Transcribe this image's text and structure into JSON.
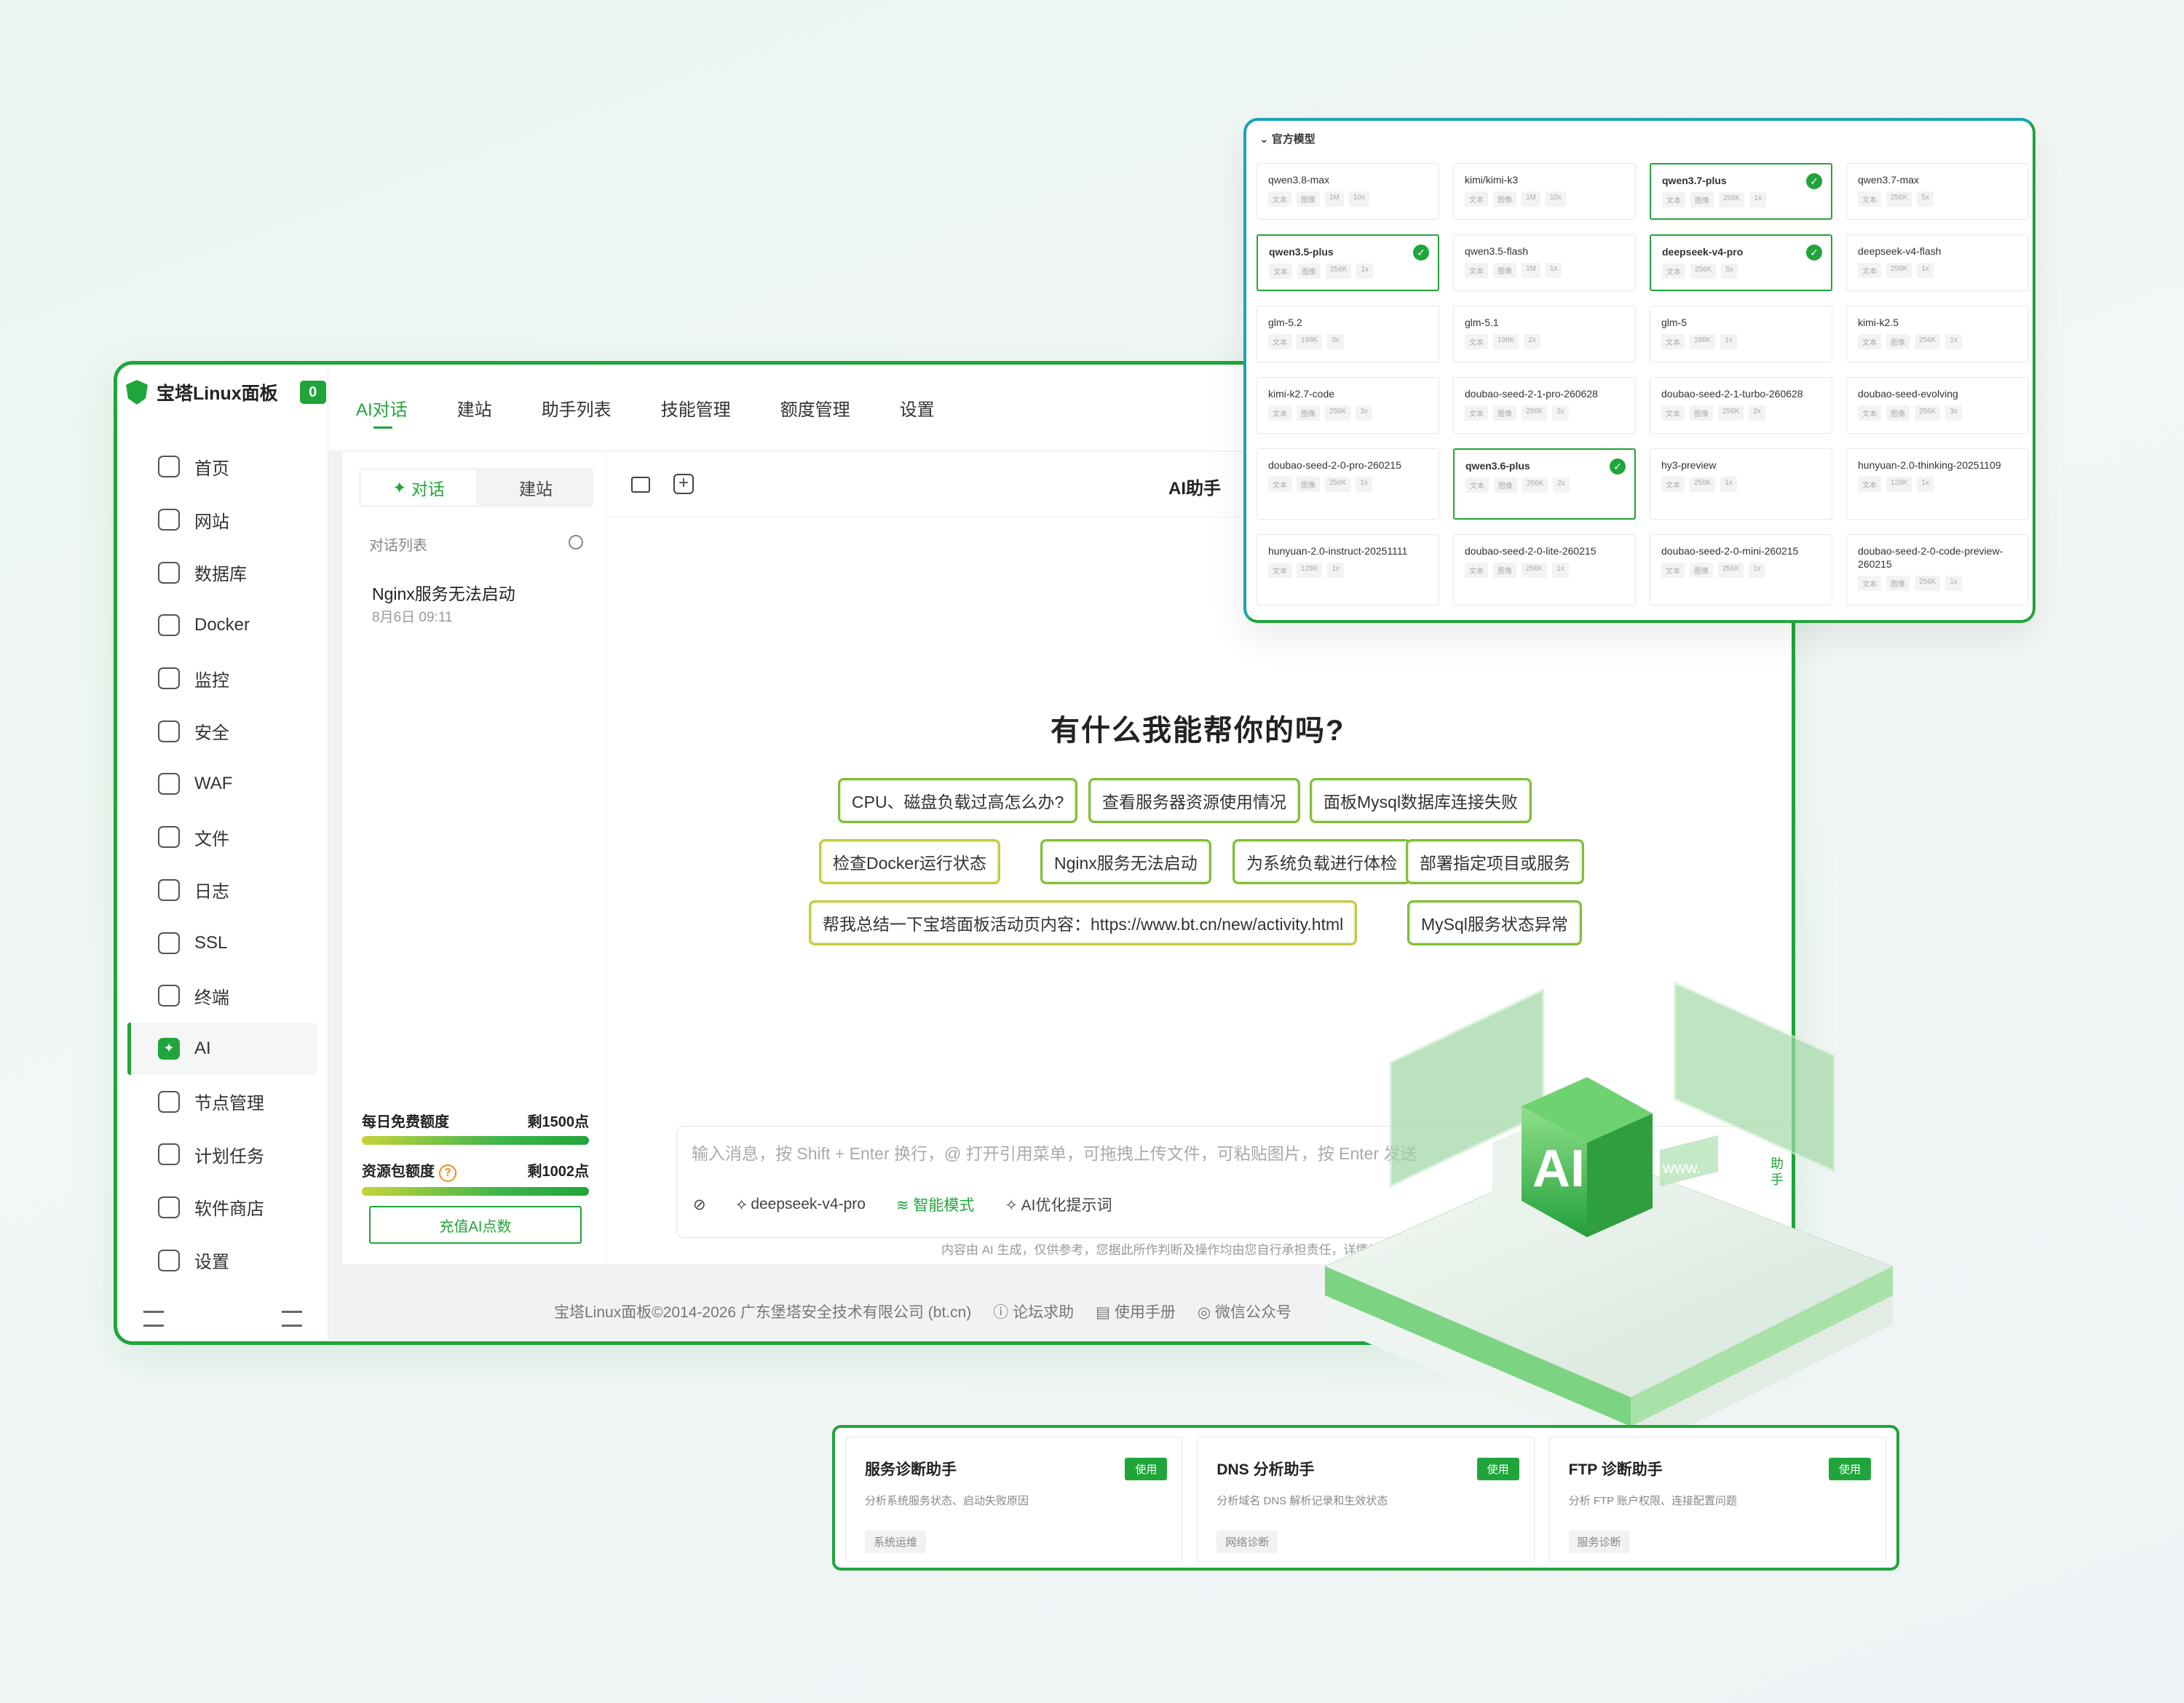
{
  "brand": {
    "name": "宝塔Linux面板",
    "badge": "0"
  },
  "sidebar": {
    "items": [
      {
        "label": "首页",
        "icon": "home-icon"
      },
      {
        "label": "网站",
        "icon": "website-icon"
      },
      {
        "label": "数据库",
        "icon": "database-icon"
      },
      {
        "label": "Docker",
        "icon": "docker-icon"
      },
      {
        "label": "监控",
        "icon": "monitor-icon"
      },
      {
        "label": "安全",
        "icon": "shield-icon"
      },
      {
        "label": "WAF",
        "icon": "waf-icon"
      },
      {
        "label": "文件",
        "icon": "folder-icon"
      },
      {
        "label": "日志",
        "icon": "log-icon"
      },
      {
        "label": "SSL",
        "icon": "ssl-icon"
      },
      {
        "label": "终端",
        "icon": "terminal-icon"
      },
      {
        "label": "AI",
        "icon": "ai-icon"
      },
      {
        "label": "节点管理",
        "icon": "node-icon"
      },
      {
        "label": "计划任务",
        "icon": "calendar-icon"
      },
      {
        "label": "软件商店",
        "icon": "store-icon"
      },
      {
        "label": "设置",
        "icon": "gear-icon"
      }
    ],
    "active": "AI"
  },
  "tabs": [
    "AI对话",
    "建站",
    "助手列表",
    "技能管理",
    "额度管理",
    "设置"
  ],
  "conversation": {
    "seg_chat": "对话",
    "seg_build": "建站",
    "list_label": "对话列表",
    "items": [
      {
        "title": "Nginx服务无法启动",
        "time": "8月6日 09:11"
      }
    ]
  },
  "quota": {
    "daily_label": "每日免费额度",
    "daily_value": "剩1500点",
    "pack_label": "资源包额度",
    "pack_value": "剩1002点",
    "recharge": "充值AI点数"
  },
  "chat": {
    "title": "AI助手",
    "welcome": "有什么我能帮你的吗?",
    "suggestions": [
      "CPU、磁盘负载过高怎么办?",
      "查看服务器资源使用情况",
      "面板Mysql数据库连接失败",
      "检查Docker运行状态",
      "Nginx服务无法启动",
      "为系统负载进行体检",
      "部署指定项目或服务",
      "帮我总结一下宝塔面板活动页内容：https://www.bt.cn/new/activity.html",
      "MySql服务状态异常"
    ],
    "placeholder": "输入消息，按 Shift + Enter 换行，@ 打开引用菜单，可拖拽上传文件，可粘贴图片，按 Enter 发送",
    "model": "deepseek-v4-pro",
    "mode": "智能模式",
    "optimize": "AI优化提示词",
    "disclaimer": "内容由 AI 生成，仅供参考，您据此所作判断及操作均由您自行承担责任，详情请"
  },
  "footer": {
    "copyright": "宝塔Linux面板©2014-2026 广东堡塔安全技术有限公司 (bt.cn)",
    "links": [
      "论坛求助",
      "使用手册",
      "微信公众号"
    ]
  },
  "models": {
    "section": "官方模型",
    "cards": [
      {
        "name": "qwen3.8-max",
        "tags": [
          "文本",
          "图像",
          "1M",
          "10x"
        ],
        "selected": false
      },
      {
        "name": "kimi/kimi-k3",
        "tags": [
          "文本",
          "图像",
          "1M",
          "10x"
        ],
        "selected": false
      },
      {
        "name": "qwen3.7-plus",
        "tags": [
          "文本",
          "图像",
          "256K",
          "1x"
        ],
        "selected": true
      },
      {
        "name": "qwen3.7-max",
        "tags": [
          "文本",
          "256K",
          "5x"
        ],
        "selected": false
      },
      {
        "name": "qwen3.5-plus",
        "tags": [
          "文本",
          "图像",
          "256K",
          "1x"
        ],
        "selected": true
      },
      {
        "name": "qwen3.5-flash",
        "tags": [
          "文本",
          "图像",
          "1M",
          "1x"
        ],
        "selected": false
      },
      {
        "name": "deepseek-v4-pro",
        "tags": [
          "文本",
          "256K",
          "5x"
        ],
        "selected": true
      },
      {
        "name": "deepseek-v4-flash",
        "tags": [
          "文本",
          "256K",
          "1x"
        ],
        "selected": false
      },
      {
        "name": "glm-5.2",
        "tags": [
          "文本",
          "198K",
          "3x"
        ],
        "selected": false
      },
      {
        "name": "glm-5.1",
        "tags": [
          "文本",
          "198K",
          "2x"
        ],
        "selected": false
      },
      {
        "name": "glm-5",
        "tags": [
          "文本",
          "198K",
          "1x"
        ],
        "selected": false
      },
      {
        "name": "kimi-k2.5",
        "tags": [
          "文本",
          "图像",
          "256K",
          "1x"
        ],
        "selected": false
      },
      {
        "name": "kimi-k2.7-code",
        "tags": [
          "文本",
          "图像",
          "256K",
          "3x"
        ],
        "selected": false
      },
      {
        "name": "doubao-seed-2-1-pro-260628",
        "tags": [
          "文本",
          "图像",
          "256K",
          "3x"
        ],
        "selected": false
      },
      {
        "name": "doubao-seed-2-1-turbo-260628",
        "tags": [
          "文本",
          "图像",
          "256K",
          "2x"
        ],
        "selected": false
      },
      {
        "name": "doubao-seed-evolving",
        "tags": [
          "文本",
          "图像",
          "256K",
          "3x"
        ],
        "selected": false
      },
      {
        "name": "doubao-seed-2-0-pro-260215",
        "tags": [
          "文本",
          "图像",
          "256K",
          "1x"
        ],
        "selected": false
      },
      {
        "name": "qwen3.6-plus",
        "tags": [
          "文本",
          "图像",
          "256K",
          "2x"
        ],
        "selected": true
      },
      {
        "name": "hy3-preview",
        "tags": [
          "文本",
          "256K",
          "1x"
        ],
        "selected": false
      },
      {
        "name": "hunyuan-2.0-thinking-20251109",
        "tags": [
          "文本",
          "128K",
          "1x"
        ],
        "selected": false
      },
      {
        "name": "hunyuan-2.0-instruct-20251111",
        "tags": [
          "文本",
          "128K",
          "1x"
        ],
        "selected": false
      },
      {
        "name": "doubao-seed-2-0-lite-260215",
        "tags": [
          "文本",
          "图像",
          "256K",
          "1x"
        ],
        "selected": false
      },
      {
        "name": "doubao-seed-2-0-mini-260215",
        "tags": [
          "文本",
          "图像",
          "256K",
          "1x"
        ],
        "selected": false
      },
      {
        "name": "doubao-seed-2-0-code-preview-260215",
        "tags": [
          "文本",
          "图像",
          "256K",
          "1x"
        ],
        "selected": false
      }
    ]
  },
  "skills": [
    {
      "name": "服务诊断助手",
      "use": "使用",
      "desc": "分析系统服务状态、启动失败原因",
      "tag": "系统运维"
    },
    {
      "name": "DNS 分析助手",
      "use": "使用",
      "desc": "分析域名 DNS 解析记录和生效状态",
      "tag": "网络诊断"
    },
    {
      "name": "FTP 诊断助手",
      "use": "使用",
      "desc": "分析 FTP 账户权限、连接配置问题",
      "tag": "服务诊断"
    }
  ],
  "illustration": {
    "ai_text": "AI",
    "www_text": "www.",
    "side_text": "助手"
  },
  "colors": {
    "accent": "#20a53a",
    "teal": "#1aa4b4",
    "chip_border": "#7fbe33"
  }
}
